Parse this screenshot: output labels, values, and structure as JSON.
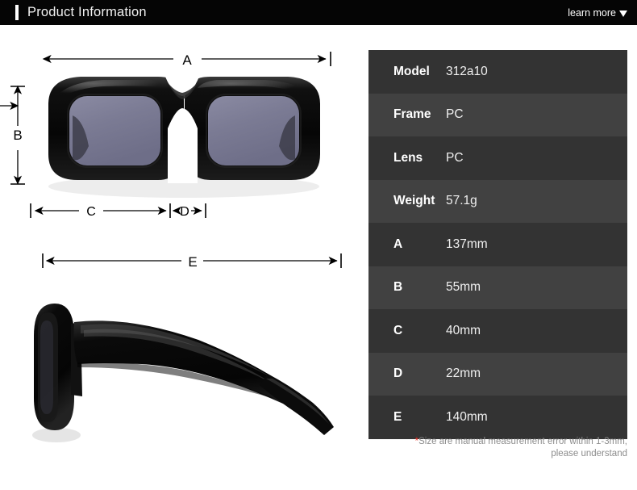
{
  "header": {
    "title": "Product Information",
    "learn_more_label": "learn more",
    "caret_icon": "chevron-down-icon",
    "background_color": "#050505",
    "accent_color": "#ffffff"
  },
  "diagram": {
    "front_view": {
      "name": "sunglasses-front-view",
      "lens_color": "#7e7e96",
      "frame_color": "#0d0d0d"
    },
    "side_view": {
      "name": "sunglasses-side-view",
      "frame_color": "#0d0d0d"
    },
    "dimension_labels": {
      "a": "A",
      "b": "B",
      "c": "C",
      "d": "D",
      "e": "E"
    }
  },
  "spec_table": {
    "row_color_odd": "#333333",
    "row_color_even": "#414141",
    "rows": [
      {
        "label": "Model",
        "value": "312a10"
      },
      {
        "label": "Frame",
        "value": "PC"
      },
      {
        "label": "Lens",
        "value": "PC"
      },
      {
        "label": "Weight",
        "value": "57.1g"
      },
      {
        "label": "A",
        "value": "137mm"
      },
      {
        "label": "B",
        "value": "55mm"
      },
      {
        "label": "C",
        "value": "40mm"
      },
      {
        "label": "D",
        "value": "22mm"
      },
      {
        "label": "E",
        "value": "140mm"
      }
    ]
  },
  "note": {
    "asterisk": "*",
    "line1": "Size are manual measurement error within 1-3mm,",
    "line2": "please understand",
    "asterisk_color": "#e8342a"
  }
}
